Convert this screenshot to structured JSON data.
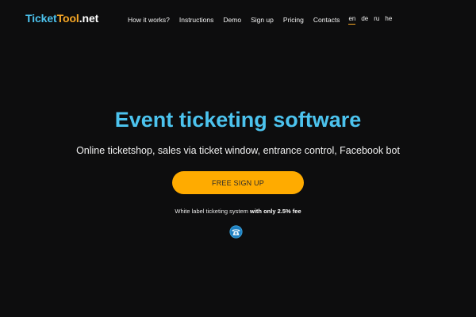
{
  "header": {
    "logo": {
      "part1": "Ticket",
      "part2": "Tool",
      "part3": ".net"
    },
    "nav": [
      {
        "label": "How it works?"
      },
      {
        "label": "Instructions"
      },
      {
        "label": "Demo"
      },
      {
        "label": "Sign up"
      },
      {
        "label": "Pricing"
      },
      {
        "label": "Contacts"
      }
    ],
    "languages": [
      {
        "label": "en",
        "active": true
      },
      {
        "label": "de"
      },
      {
        "label": "ru"
      },
      {
        "label": "he"
      }
    ]
  },
  "hero": {
    "title": "Event ticketing software",
    "subtitle": "Online ticketshop, sales via ticket window, entrance control, Facebook bot",
    "cta_label": "FREE SIGN UP",
    "fee_text": "White label ticketing system",
    "fee_bold": "with only 2.5% fee",
    "phone_icon": "phone-icon"
  },
  "colors": {
    "background": "#0d0d0e",
    "accent_blue": "#4cc3ee",
    "accent_orange": "#ffab00"
  }
}
